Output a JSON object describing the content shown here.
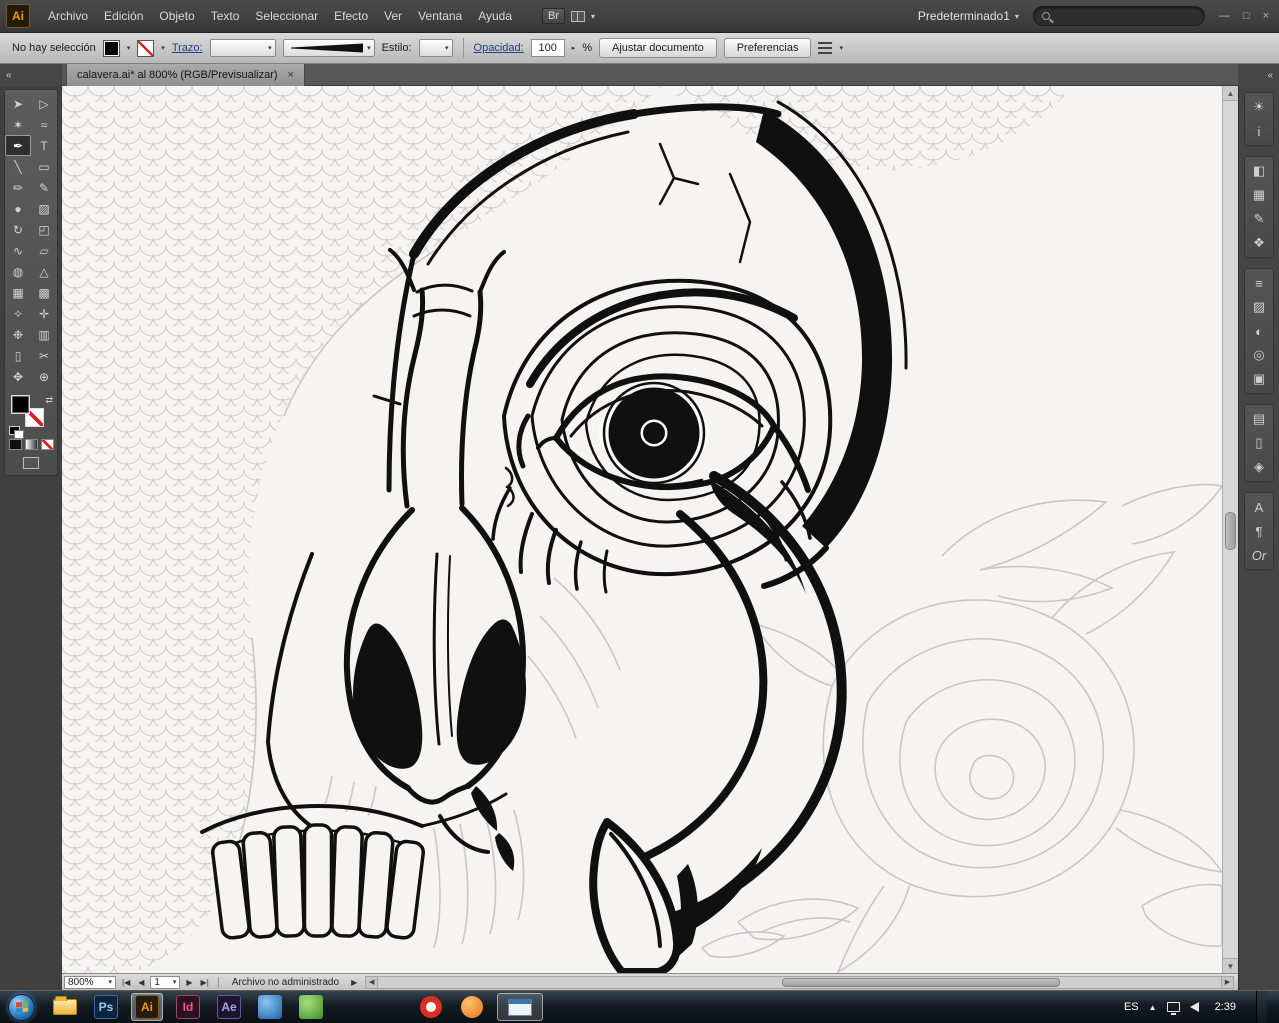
{
  "menubar": {
    "app_badge": "Ai",
    "items": [
      {
        "label": "Archivo"
      },
      {
        "label": "Edición"
      },
      {
        "label": "Objeto"
      },
      {
        "label": "Texto"
      },
      {
        "label": "Seleccionar"
      },
      {
        "label": "Efecto"
      },
      {
        "label": "Ver"
      },
      {
        "label": "Ventana"
      },
      {
        "label": "Ayuda"
      }
    ],
    "bridge_button": "Br",
    "arrange_caret": "▾",
    "workspace_switcher": {
      "label": "Predeterminado1",
      "caret": "▾"
    },
    "search": {
      "placeholder": ""
    },
    "window_controls": {
      "minimize": "—",
      "restore": "□",
      "close": "×"
    }
  },
  "controlbar": {
    "selection_status": "No hay selección",
    "fill_swatch_color": "#000000",
    "stroke_label": "Trazo:",
    "style_label": "Estilo:",
    "opacity_label": "Opacidad:",
    "opacity_value": "100",
    "opacity_spinner": "▸",
    "opacity_unit": "%",
    "fit_document_button": "Ajustar documento",
    "preferences_button": "Preferencias",
    "caret": "▾"
  },
  "tabbar": {
    "collapse_left": "«",
    "collapse_right": "«",
    "tab": {
      "title": "calavera.ai* al 800% (RGB/Previsualizar)",
      "close": "×"
    }
  },
  "toolbar": {
    "active_tool": "pen-tool",
    "tools": [
      {
        "name": "selection-tool",
        "glyph": "➤"
      },
      {
        "name": "direct-selection-tool",
        "glyph": "▷"
      },
      {
        "name": "magic-wand-tool",
        "glyph": "✶"
      },
      {
        "name": "lasso-tool",
        "glyph": "≈"
      },
      {
        "name": "pen-tool",
        "glyph": "✒"
      },
      {
        "name": "type-tool",
        "glyph": "T"
      },
      {
        "name": "line-tool",
        "glyph": "╲"
      },
      {
        "name": "rectangle-tool",
        "glyph": "▭"
      },
      {
        "name": "paintbrush-tool",
        "glyph": "✏"
      },
      {
        "name": "pencil-tool",
        "glyph": "✎"
      },
      {
        "name": "blob-brush-tool",
        "glyph": "●"
      },
      {
        "name": "eraser-tool",
        "glyph": "▨"
      },
      {
        "name": "rotate-tool",
        "glyph": "↻"
      },
      {
        "name": "scale-tool",
        "glyph": "◰"
      },
      {
        "name": "width-tool",
        "glyph": "∿"
      },
      {
        "name": "free-transform-tool",
        "glyph": "▱"
      },
      {
        "name": "shape-builder-tool",
        "glyph": "◍"
      },
      {
        "name": "perspective-grid-tool",
        "glyph": "△"
      },
      {
        "name": "mesh-tool",
        "glyph": "▦"
      },
      {
        "name": "gradient-tool",
        "glyph": "▩"
      },
      {
        "name": "eyedropper-tool",
        "glyph": "✧"
      },
      {
        "name": "blend-tool",
        "glyph": "✛"
      },
      {
        "name": "symbol-sprayer-tool",
        "glyph": "❉"
      },
      {
        "name": "column-graph-tool",
        "glyph": "▥"
      },
      {
        "name": "artboard-tool",
        "glyph": "▯"
      },
      {
        "name": "slice-tool",
        "glyph": "✂"
      },
      {
        "name": "hand-tool",
        "glyph": "✥"
      },
      {
        "name": "zoom-tool",
        "glyph": "⊕"
      }
    ]
  },
  "dock": {
    "panels": [
      {
        "name": "color-panel",
        "glyph": "☀"
      },
      {
        "name": "info-panel",
        "glyph": "i"
      },
      {
        "name": "color-guide-panel",
        "glyph": "◧"
      },
      {
        "name": "swatches-panel",
        "glyph": "▦"
      },
      {
        "name": "brushes-panel",
        "glyph": "✎"
      },
      {
        "name": "symbols-panel",
        "glyph": "❖"
      },
      {
        "name": "stroke-panel",
        "glyph": "≡"
      },
      {
        "name": "gradient-panel",
        "glyph": "▨"
      },
      {
        "name": "transparency-panel",
        "glyph": "◐"
      },
      {
        "name": "appearance-panel",
        "glyph": "◎"
      },
      {
        "name": "graphic-styles-panel",
        "glyph": "▣"
      },
      {
        "name": "layers-panel",
        "glyph": "▤"
      },
      {
        "name": "artboards-panel",
        "glyph": "▯"
      },
      {
        "name": "navigator-panel",
        "glyph": "◈"
      },
      {
        "name": "character-panel",
        "glyph": "A"
      },
      {
        "name": "paragraph-panel",
        "glyph": "¶"
      },
      {
        "name": "opentype-panel",
        "glyph": "Or"
      }
    ]
  },
  "statusbar": {
    "zoom": "800%",
    "zoom_caret": "▾",
    "nav": {
      "first": "|◀",
      "prev": "◀",
      "next": "▶",
      "last": "▶|"
    },
    "artboard_value": "1",
    "artboard_caret": "▾",
    "status_text": "Archivo no administrado",
    "status_arrow": "▶"
  },
  "taskbar": {
    "apps": [
      {
        "name": "explorer-icon",
        "label": ""
      },
      {
        "name": "photoshop-icon",
        "label": "Ps"
      },
      {
        "name": "illustrator-icon",
        "label": "Ai"
      },
      {
        "name": "indesign-icon",
        "label": "Id"
      },
      {
        "name": "after-effects-icon",
        "label": "Ae"
      },
      {
        "name": "app-blue-icon",
        "label": ""
      },
      {
        "name": "app-green-icon",
        "label": ""
      },
      {
        "name": "app-red-icon",
        "label": ""
      },
      {
        "name": "app-orange-icon",
        "label": ""
      },
      {
        "name": "active-window-icon",
        "label": ""
      }
    ],
    "tray": {
      "expand_glyph": "▲",
      "language": "ES",
      "time": "2:39"
    }
  }
}
